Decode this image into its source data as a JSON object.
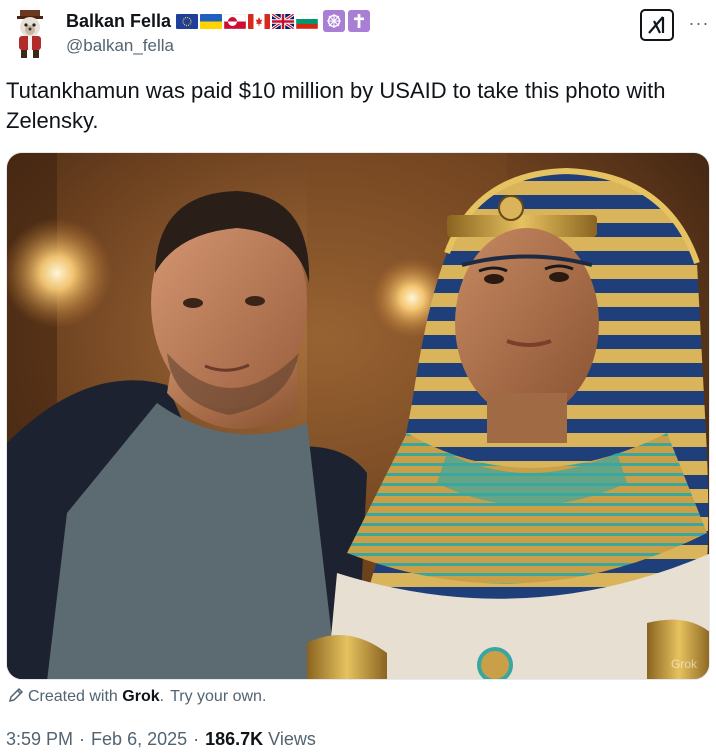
{
  "author": {
    "display_name": "Balkan Fella",
    "handle": "@balkan_fella",
    "avatar_icon": "bear-avatar-icon",
    "flags": [
      "eu-flag-icon",
      "ukraine-flag-icon",
      "greenland-flag-icon",
      "canada-flag-icon",
      "uk-flag-icon",
      "bulgaria-flag-icon"
    ],
    "symbols": [
      "dharma-wheel-icon",
      "latin-cross-icon"
    ]
  },
  "toolbar": {
    "grok_icon": "grok-logo-icon",
    "more_label": "···"
  },
  "tweet": {
    "text": "Tutankhamun was paid $10 million by USAID to take this photo with Zelensky."
  },
  "media": {
    "watermark": "Grok"
  },
  "credit": {
    "prefix": "Created with",
    "tool": "Grok",
    "period": ".",
    "cta": "Try your own."
  },
  "meta": {
    "time": "3:59 PM",
    "dot1": "·",
    "date": "Feb 6, 2025",
    "dot2": "·",
    "views_count": "186.7K",
    "views_label": "Views"
  },
  "colors": {
    "text_primary": "#0f1419",
    "text_secondary": "#536471",
    "symbol_bg": "#a97fd6"
  }
}
